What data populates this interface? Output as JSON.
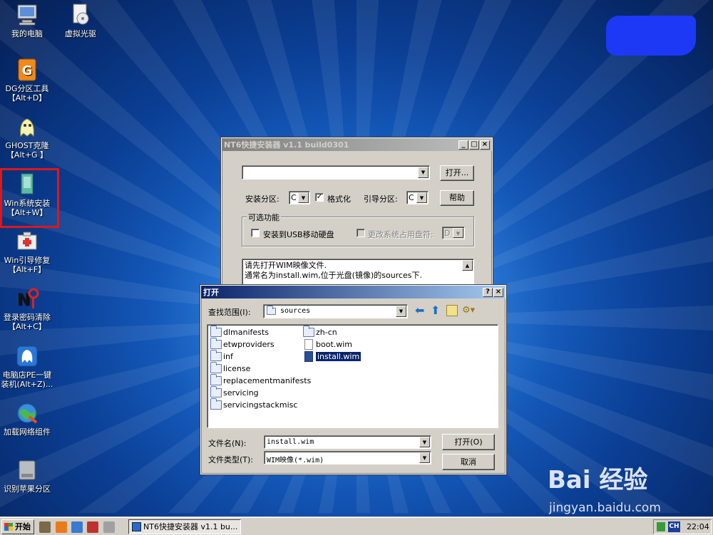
{
  "desktop": {
    "icons": [
      {
        "label": "我的电脑",
        "icon": "computer-icon"
      },
      {
        "label": "虚拟光驱",
        "icon": "virtual-drive-icon"
      },
      {
        "label": "DG分区工具\n【Alt+D】",
        "icon": "diskgenius-icon"
      },
      {
        "label": "GHOST克隆\n【Alt+G 】",
        "icon": "ghost-icon"
      },
      {
        "label": "Win系统安装\n【Alt+W】",
        "icon": "win-install-icon"
      },
      {
        "label": "Win引导修复\n【Alt+F】",
        "icon": "boot-repair-icon"
      },
      {
        "label": "登录密码清除\n【Alt+C】",
        "icon": "password-clear-icon"
      },
      {
        "label": "电脑店PE一键\n装机(Alt+Z)...",
        "icon": "pe-install-icon"
      },
      {
        "label": "加载网络组件",
        "icon": "network-icon"
      },
      {
        "label": "识别苹果分区",
        "icon": "apple-partition-icon"
      }
    ]
  },
  "installer": {
    "title": "NT6快捷安装器 v1.1 build0301",
    "wim_path": "",
    "open_button": "打开...",
    "install_partition_label": "安装分区:",
    "install_partition_value": "C",
    "format_label": "格式化",
    "format_checked": true,
    "boot_partition_label": "引导分区:",
    "boot_partition_value": "C",
    "help_button": "帮助",
    "optional_group": "可选功能",
    "usb_label": "安装到USB移动硬盘",
    "change_letter_label": "更改系统占用盘符:",
    "change_letter_value": "D",
    "info_line1": "请先打开WIM映像文件.",
    "info_line2": "通常名为install.wim,位于光盘(镜像)的sources下."
  },
  "open_dialog": {
    "title": "打开",
    "lookin_label": "查找范围(I):",
    "lookin_value": "sources",
    "files": [
      {
        "name": "dlmanifests",
        "type": "folder"
      },
      {
        "name": "etwproviders",
        "type": "folder"
      },
      {
        "name": "inf",
        "type": "folder"
      },
      {
        "name": "license",
        "type": "folder"
      },
      {
        "name": "replacementmanifests",
        "type": "folder"
      },
      {
        "name": "servicing",
        "type": "folder"
      },
      {
        "name": "servicingstackmisc",
        "type": "folder"
      },
      {
        "name": "zh-cn",
        "type": "folder"
      },
      {
        "name": "boot.wim",
        "type": "file"
      },
      {
        "name": "install.wim",
        "type": "wim",
        "selected": true
      }
    ],
    "filename_label": "文件名(N):",
    "filename_value": "install.wim",
    "filetype_label": "文件类型(T):",
    "filetype_value": "WIM映像(*.wim)",
    "open_button": "打开(O)",
    "cancel_button": "取消"
  },
  "taskbar": {
    "start_label": "开始",
    "task_label": "NT6快捷安装器 v1.1 bu...",
    "ime_label": "CH",
    "clock": "22:04"
  },
  "watermark": {
    "brand": "Bai 经验",
    "url": "jingyan.baidu.com"
  },
  "colors": {
    "selection_border": "#e0161b",
    "active_title": "#0a246a",
    "redaction_blob": "#1d39f5"
  }
}
